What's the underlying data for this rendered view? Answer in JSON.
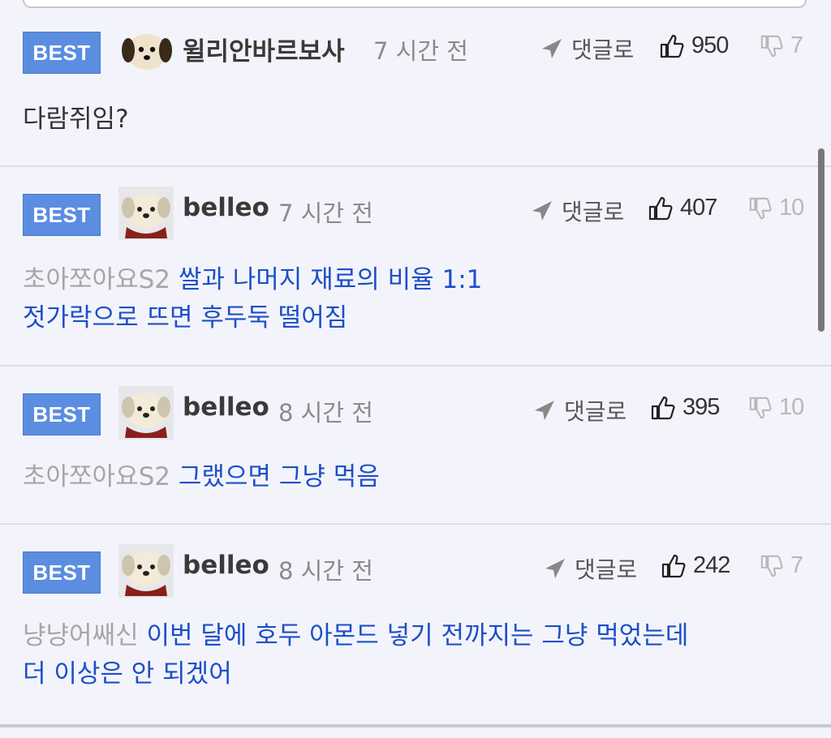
{
  "comments": [
    {
      "badge": "BEST",
      "user": "윌리안바르보사",
      "time": "7 시간 전",
      "reply_label": "댓글로",
      "likes": "950",
      "dislikes": "7",
      "text": "다람쥐임?"
    },
    {
      "badge": "BEST",
      "user": "belleo",
      "time": "7 시간 전",
      "reply_label": "댓글로",
      "likes": "407",
      "dislikes": "10",
      "mention": "초아쪼아요S2",
      "line1": "쌀과 나머지 재료의 비율 1:1",
      "line2": "젓가락으로 뜨면 후두둑 떨어짐"
    },
    {
      "badge": "BEST",
      "user": "belleo",
      "time": "8 시간 전",
      "reply_label": "댓글로",
      "likes": "395",
      "dislikes": "10",
      "mention": "초아쪼아요S2",
      "line1": "그랬으면 그냥 먹음"
    },
    {
      "badge": "BEST",
      "user": "belleo",
      "time": "8 시간 전",
      "reply_label": "댓글로",
      "likes": "242",
      "dislikes": "7",
      "mention": "냥냥어쌔신",
      "line1": "이번 달에 호두 아몬드 넣기 전까지는 그냥 먹었는데",
      "line2": "더 이상은 안 되겠어"
    }
  ],
  "colors": {
    "background": "#f3f4fb",
    "badge": "#5b8de0",
    "quote_text": "#1d4fc7",
    "mention_text": "#a6a6a6"
  },
  "icons": [
    "reply-arrow-icon",
    "thumbs-up-icon",
    "thumbs-down-icon",
    "dog-avatar-icon",
    "puppy-avatar-icon"
  ]
}
